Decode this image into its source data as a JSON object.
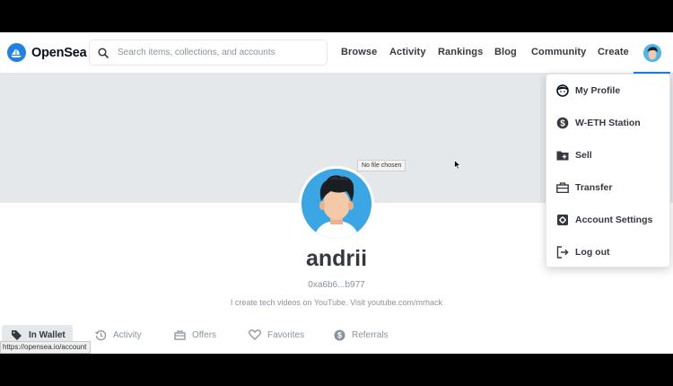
{
  "brand": {
    "name": "OpenSea",
    "logo_icon": "opensea-logo-icon",
    "accent_color": "#2081e2"
  },
  "search": {
    "placeholder": "Search items, collections, and accounts",
    "icon": "search-icon"
  },
  "nav": {
    "links": [
      {
        "label": "Browse"
      },
      {
        "label": "Activity"
      },
      {
        "label": "Rankings"
      },
      {
        "label": "Blog"
      },
      {
        "label": "Community"
      },
      {
        "label": "Create"
      }
    ],
    "avatar_icon": "avatar-icon"
  },
  "banner": {
    "file_input_text": "No file chosen",
    "color": "#e5e8eb"
  },
  "profile": {
    "username": "andrii",
    "address": "0xa6b6...b977",
    "bio": "I create tech videos on YouTube. Visit youtube.com/mrhack"
  },
  "tabs": [
    {
      "label": "In Wallet",
      "icon": "tag-icon",
      "active": true
    },
    {
      "label": "Activity",
      "icon": "history-icon",
      "active": false
    },
    {
      "label": "Offers",
      "icon": "gift-icon",
      "active": false
    },
    {
      "label": "Favorites",
      "icon": "heart-icon",
      "active": false
    },
    {
      "label": "Referrals",
      "icon": "dollar-circle-icon",
      "active": false
    }
  ],
  "status_url": "https://opensea.io/account",
  "dropdown": {
    "items": [
      {
        "label": "My Profile",
        "icon": "face-icon"
      },
      {
        "label": "W-ETH Station",
        "icon": "dollar-circle-icon"
      },
      {
        "label": "Sell",
        "icon": "folder-plus-icon"
      },
      {
        "label": "Transfer",
        "icon": "briefcase-icon"
      },
      {
        "label": "Account Settings",
        "icon": "settings-icon"
      },
      {
        "label": "Log out",
        "icon": "logout-icon"
      }
    ]
  }
}
